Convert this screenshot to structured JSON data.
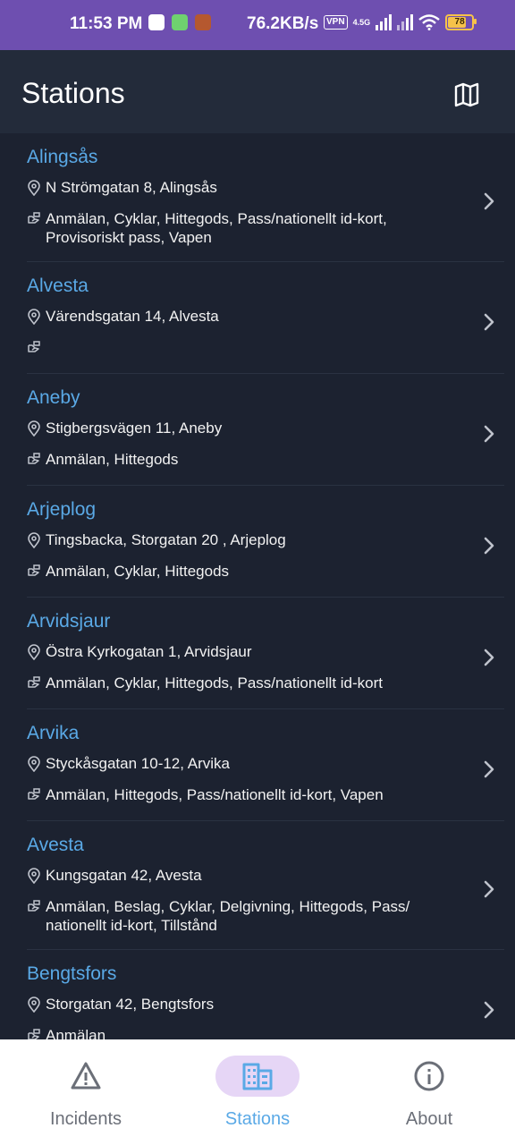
{
  "status_bar": {
    "time": "11:53 PM",
    "speed": "76.2KB/s",
    "vpn": "VPN",
    "network": "4.5G",
    "battery": "78"
  },
  "header": {
    "title": "Stations",
    "map_icon": "map-icon"
  },
  "stations": [
    {
      "name": "Alingsås",
      "address": "N Strömgatan 8, Alingsås",
      "services": "Anmälan, Cyklar, Hittegods, Pass/nationellt id-kort, Provisoriskt pass, Vapen"
    },
    {
      "name": "Alvesta",
      "address": "Värendsgatan 14, Alvesta",
      "services": ""
    },
    {
      "name": "Aneby",
      "address": "Stigbergsvägen 11, Aneby",
      "services": "Anmälan, Hittegods"
    },
    {
      "name": "Arjeplog",
      "address": "Tingsbacka, Storgatan 20   , Arjeplog",
      "services": "Anmälan, Cyklar, Hittegods"
    },
    {
      "name": "Arvidsjaur",
      "address": "Östra Kyrkogatan 1, Arvidsjaur",
      "services": "Anmälan, Cyklar, Hittegods, Pass/nationellt id-kort"
    },
    {
      "name": "Arvika",
      "address": "Styckåsgatan 10-12, Arvika",
      "services": "Anmälan, Hittegods, Pass/nationellt id-kort, Vapen"
    },
    {
      "name": "Avesta",
      "address": "Kungsgatan 42, Avesta",
      "services": "Anmälan, Beslag, Cyklar, Delgivning, Hittegods, Pass/ nationellt id-kort, Tillstånd"
    },
    {
      "name": "Bengtsfors",
      "address": "Storgatan 42, Bengtsfors",
      "services": "Anmälan"
    }
  ],
  "bottom_nav": {
    "items": [
      {
        "label": "Incidents",
        "icon": "warning-icon",
        "active": false
      },
      {
        "label": "Stations",
        "icon": "building-icon",
        "active": true
      },
      {
        "label": "About",
        "icon": "info-icon",
        "active": false
      }
    ]
  },
  "colors": {
    "accent": "#5aa9e6",
    "background": "#1c2230",
    "header": "#232b3a",
    "status_bar": "#6e4fb0",
    "active_pill": "#e6d6f6"
  }
}
